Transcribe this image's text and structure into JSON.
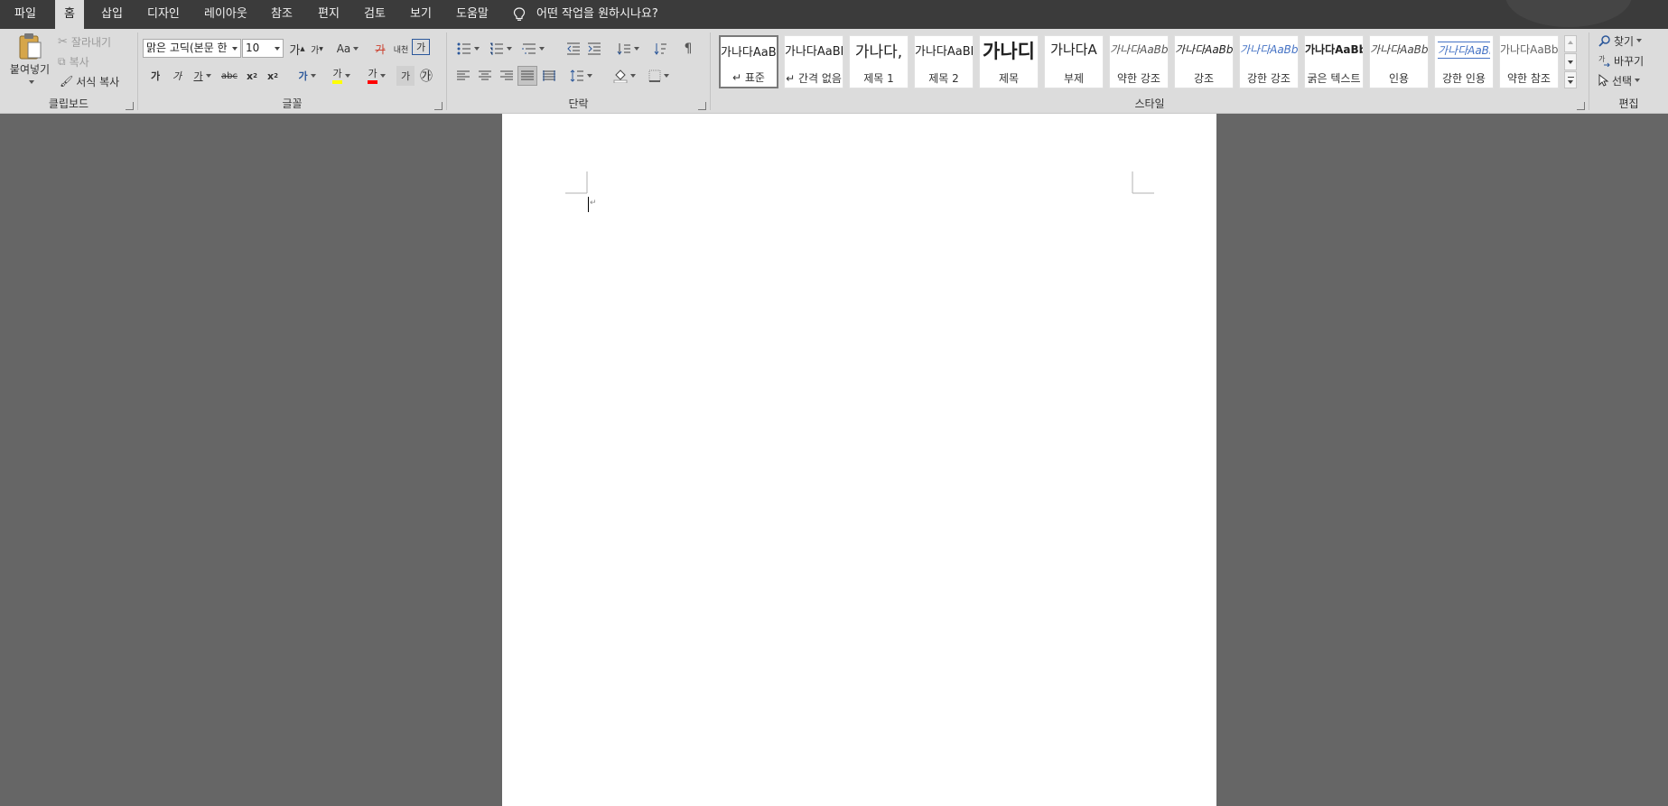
{
  "tabs": [
    {
      "label": "파일",
      "active": false
    },
    {
      "label": "홈",
      "active": true
    },
    {
      "label": "삽입",
      "active": false
    },
    {
      "label": "디자인",
      "active": false
    },
    {
      "label": "레이아웃",
      "active": false
    },
    {
      "label": "참조",
      "active": false
    },
    {
      "label": "편지",
      "active": false
    },
    {
      "label": "검토",
      "active": false
    },
    {
      "label": "보기",
      "active": false
    },
    {
      "label": "도움말",
      "active": false
    }
  ],
  "tell_me": "어떤 작업을 원하시나요?",
  "clipboard": {
    "group_label": "클립보드",
    "paste": "붙여넣기",
    "cut": "잘라내기",
    "copy": "복사",
    "format_painter": "서식 복사"
  },
  "font": {
    "group_label": "글꼴",
    "font_name": "맑은 고딕(본문 한",
    "font_size": "10",
    "grow": "가",
    "shrink": "가",
    "change_case": "Aa",
    "clear_format": "가",
    "phonetic": "내천",
    "char_border": "가",
    "bold": "가",
    "italic": "가",
    "underline": "가",
    "strike": "abc",
    "subscript": "x",
    "superscript": "x",
    "text_effect": "가",
    "highlight": "가",
    "font_color": "가",
    "char_shading": "가",
    "enclosed": "㉮",
    "highlight_color": "#ffff00",
    "font_color_value": "#ff0000"
  },
  "paragraph": {
    "group_label": "단락"
  },
  "styles": {
    "group_label": "스타일",
    "items": [
      {
        "preview": "가나다AaBb",
        "name": "표준"
      },
      {
        "preview": "가나다AaBb",
        "name": "간격 없음"
      },
      {
        "preview": "가나다,",
        "name": "제목 1"
      },
      {
        "preview": "가나다AaBb",
        "name": "제목 2"
      },
      {
        "preview": "가나디",
        "name": "제목"
      },
      {
        "preview": "가나다A",
        "name": "부제"
      },
      {
        "preview": "가나다AaBb",
        "name": "약한 강조"
      },
      {
        "preview": "가나다AaBb",
        "name": "강조"
      },
      {
        "preview": "가나다AaBb",
        "name": "강한 강조"
      },
      {
        "preview": "가나다AaBb",
        "name": "굵은 텍스트"
      },
      {
        "preview": "가나다AaBb",
        "name": "인용"
      },
      {
        "preview": "가나다AaBb",
        "name": "강한 인용"
      },
      {
        "preview": "가나다AaBb",
        "name": "약한 참조"
      }
    ]
  },
  "editing": {
    "group_label": "편집",
    "find": "찾기",
    "replace": "바꾸기",
    "select": "선택"
  },
  "colors": {
    "tabbar": "#3b3b3b",
    "ribbon": "#dcdcdc",
    "canvas": "#666666",
    "page": "#ffffff",
    "accent_blue": "#2b579a"
  }
}
